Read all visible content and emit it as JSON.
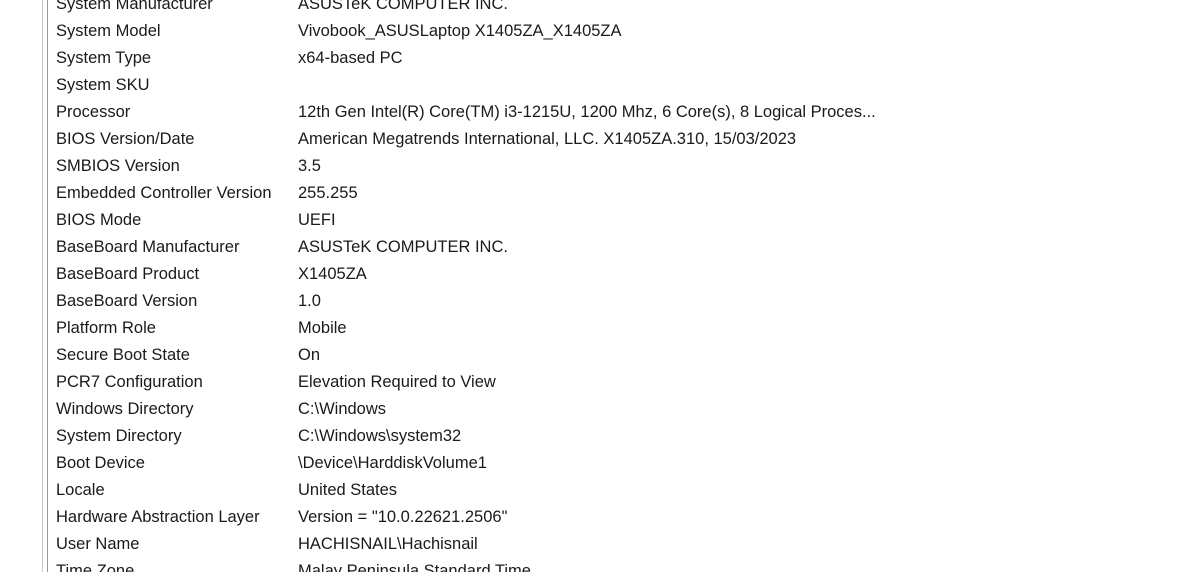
{
  "rows": [
    {
      "item": "System Manufacturer",
      "value": "ASUSTeK COMPUTER INC."
    },
    {
      "item": "System Model",
      "value": "Vivobook_ASUSLaptop X1405ZA_X1405ZA"
    },
    {
      "item": "System Type",
      "value": "x64-based PC"
    },
    {
      "item": "System SKU",
      "value": ""
    },
    {
      "item": "Processor",
      "value": "12th Gen Intel(R) Core(TM) i3-1215U, 1200 Mhz, 6 Core(s), 8 Logical Proces..."
    },
    {
      "item": "BIOS Version/Date",
      "value": "American Megatrends International, LLC. X1405ZA.310, 15/03/2023"
    },
    {
      "item": "SMBIOS Version",
      "value": "3.5"
    },
    {
      "item": "Embedded Controller Version",
      "value": "255.255"
    },
    {
      "item": "BIOS Mode",
      "value": "UEFI"
    },
    {
      "item": "BaseBoard Manufacturer",
      "value": "ASUSTeK COMPUTER INC."
    },
    {
      "item": "BaseBoard Product",
      "value": "X1405ZA"
    },
    {
      "item": "BaseBoard Version",
      "value": "1.0"
    },
    {
      "item": "Platform Role",
      "value": "Mobile"
    },
    {
      "item": "Secure Boot State",
      "value": "On"
    },
    {
      "item": "PCR7 Configuration",
      "value": "Elevation Required to View"
    },
    {
      "item": "Windows Directory",
      "value": "C:\\Windows"
    },
    {
      "item": "System Directory",
      "value": "C:\\Windows\\system32"
    },
    {
      "item": "Boot Device",
      "value": "\\Device\\HarddiskVolume1"
    },
    {
      "item": "Locale",
      "value": "United States"
    },
    {
      "item": "Hardware Abstraction Layer",
      "value": "Version = \"10.0.22621.2506\""
    },
    {
      "item": "User Name",
      "value": "HACHISNAIL\\Hachisnail"
    },
    {
      "item": "Time Zone",
      "value": "Malay Peninsula Standard Time"
    }
  ]
}
